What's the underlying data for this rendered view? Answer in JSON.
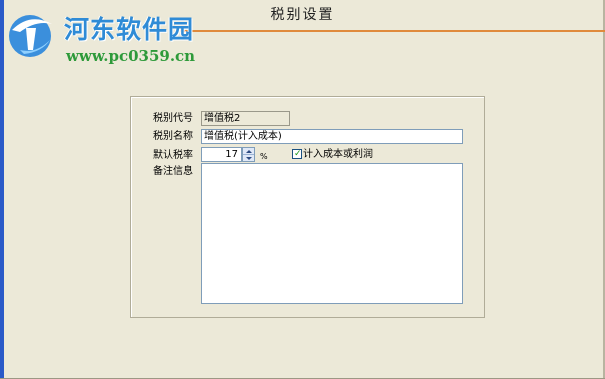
{
  "window": {
    "title": "税别设置"
  },
  "watermark": {
    "name": "河东软件园",
    "url": "www.pc0359.cn"
  },
  "form": {
    "code_label": "税别代号",
    "code_value": "增值税2",
    "name_label": "税别名称",
    "name_value": "增值税(计入成本)",
    "rate_label": "默认税率",
    "rate_value": "17",
    "rate_unit": "%",
    "include_cost_label": "计入成本或利润",
    "include_cost_checked": true,
    "notes_label": "备注信息",
    "notes_value": ""
  },
  "colors": {
    "window_bg": "#ece9d8",
    "accent_line": "#e08a3c",
    "frame_blue": "#2a5ac8",
    "field_border": "#7f9db9"
  },
  "icons": {
    "checkbox_mark": "check-icon",
    "spin_up": "spin-up-arrow-icon",
    "spin_down": "spin-down-arrow-icon",
    "logo": "hedong-logo-icon"
  }
}
